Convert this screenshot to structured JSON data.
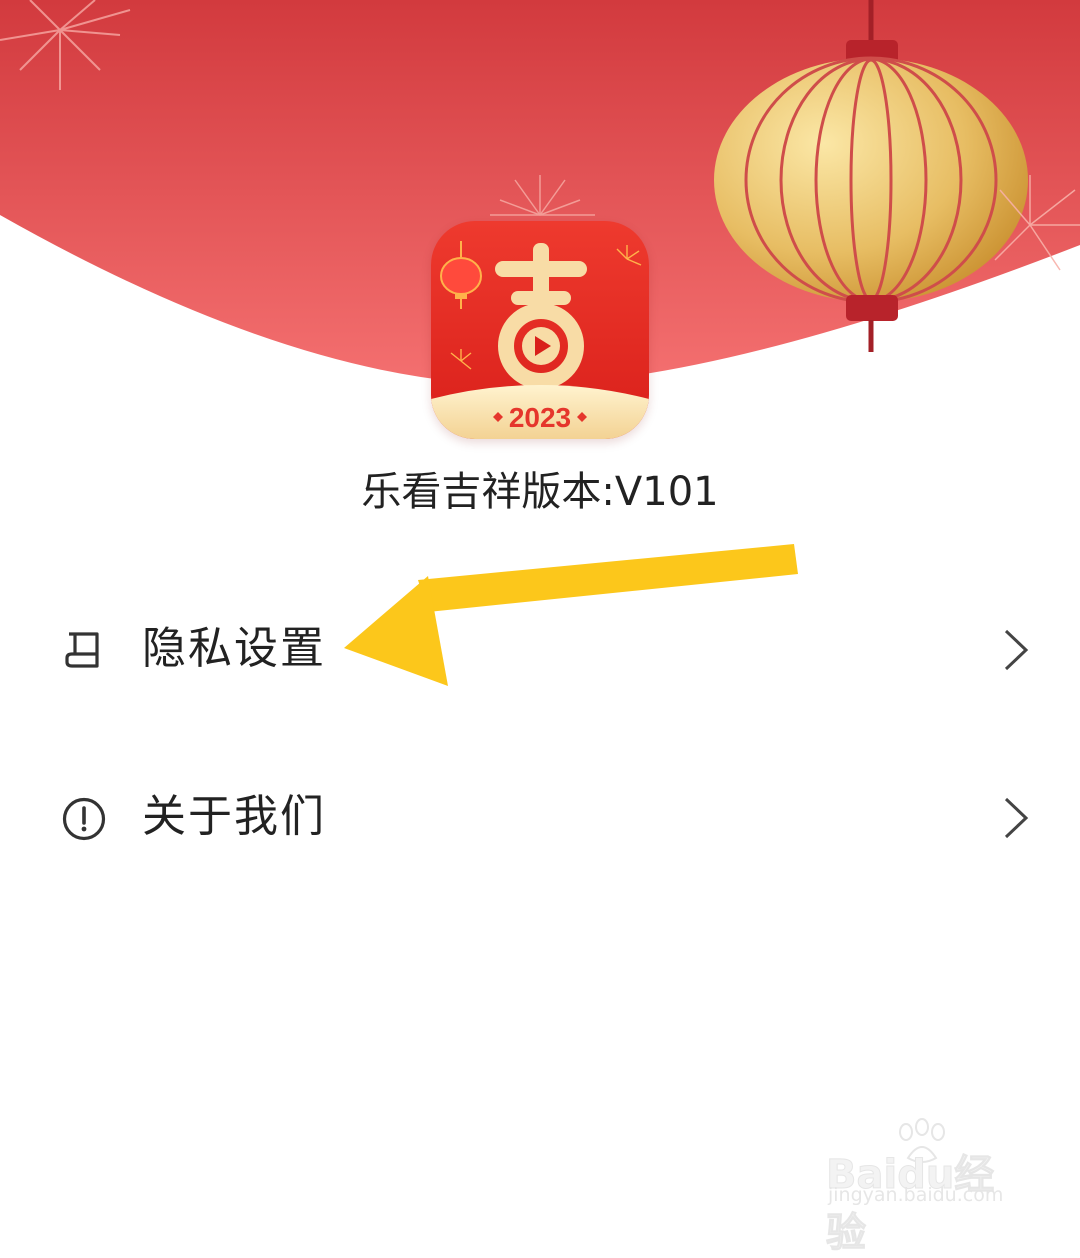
{
  "app": {
    "logo_year": "2023",
    "logo_character": "吉",
    "version_text": "乐看吉祥版本:V101"
  },
  "menu": [
    {
      "label": "隐私设置",
      "icon": "book-icon"
    },
    {
      "label": "关于我们",
      "icon": "info-circle-icon"
    }
  ],
  "watermark": {
    "main": "Baidu经验",
    "sub": "jingyan.baidu.com"
  },
  "colors": {
    "header_red": "#dc4446",
    "header_red_light": "#f36b6c",
    "lantern_gold": "#e9c06a",
    "annotation_arrow": "#fcc71b",
    "text_primary": "#222222",
    "icon_gray": "#333333"
  }
}
